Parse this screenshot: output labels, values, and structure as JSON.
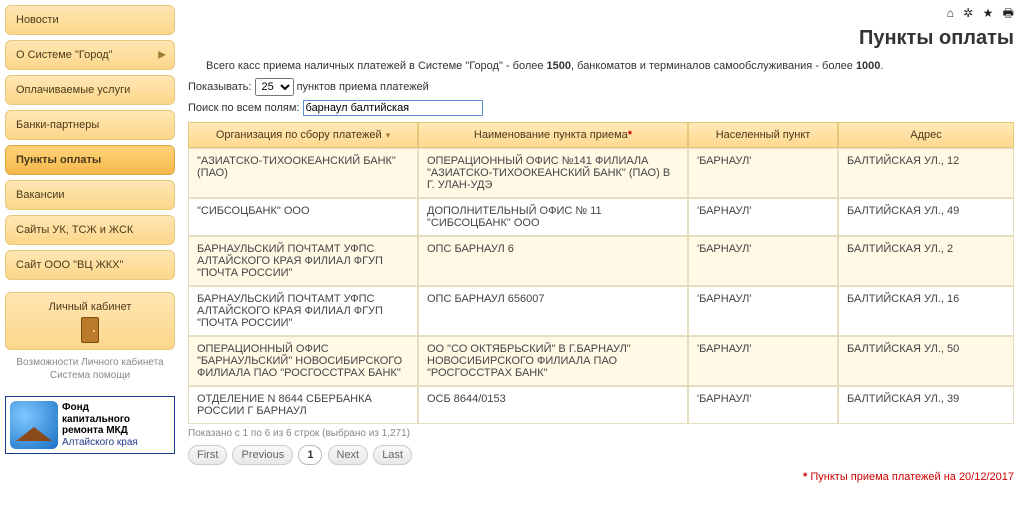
{
  "header": {
    "title": "Пункты оплаты"
  },
  "sidebar": {
    "items": [
      {
        "label": "Новости",
        "arrow": false
      },
      {
        "label": "О Системе \"Город\"",
        "arrow": true
      },
      {
        "label": "Оплачиваемые услуги",
        "arrow": false
      },
      {
        "label": "Банки-партнеры",
        "arrow": false
      },
      {
        "label": "Пункты оплаты",
        "arrow": false,
        "active": true
      },
      {
        "label": "Вакансии",
        "arrow": false
      },
      {
        "label": "Сайты УК, ТСЖ и ЖСК",
        "arrow": false
      },
      {
        "label": "Сайт ООО \"ВЦ ЖКХ\"",
        "arrow": false
      }
    ],
    "lk_label": "Личный кабинет",
    "lk_caption1": "Возможности Личного кабинета",
    "lk_caption2": "Система помощи",
    "banner": {
      "l1": "Фонд",
      "l2": "капитального",
      "l3": "ремонта МКД",
      "l4": "Алтайского края"
    }
  },
  "intro": {
    "prefix": "Всего касс приема наличных платежей в Системе \"Город\" - более ",
    "num1": "1500",
    "mid": ", банкоматов и терминалов самообслуживания - более ",
    "num2": "1000",
    "suffix": "."
  },
  "controls": {
    "show_label": "Показывать: ",
    "show_value": "25",
    "show_suffix": " пунктов приема платежей",
    "search_label": "Поиск по всем полям: ",
    "search_value": "барнаул балтийская"
  },
  "table": {
    "headers": {
      "org": "Организация по сбору платежей",
      "name": "Наименование пункта приема",
      "city": "Населенный пункт",
      "addr": "Адрес"
    },
    "rows": [
      {
        "org": "\"АЗИАТСКО-ТИХООКЕАНСКИЙ БАНК\" (ПАО)",
        "name": "ОПЕРАЦИОННЫЙ ОФИС №141 ФИЛИАЛА \"АЗИАТСКО-ТИХООКЕАНСКИЙ БАНК\" (ПАО) В Г. УЛАН-УДЭ",
        "city": "'БАРНАУЛ'",
        "addr": "БАЛТИЙСКАЯ УЛ., 12"
      },
      {
        "org": "\"СИБСОЦБАНК\" ООО",
        "name": "ДОПОЛНИТЕЛЬНЫЙ ОФИС № 11 \"СИБСОЦБАНК\" ООО",
        "city": "'БАРНАУЛ'",
        "addr": "БАЛТИЙСКАЯ УЛ., 49"
      },
      {
        "org": "БАРНАУЛЬСКИЙ ПОЧТАМТ УФПС АЛТАЙСКОГО КРАЯ ФИЛИАЛ ФГУП \"ПОЧТА РОССИИ\"",
        "name": "ОПС БАРНАУЛ 6",
        "city": "'БАРНАУЛ'",
        "addr": "БАЛТИЙСКАЯ УЛ., 2"
      },
      {
        "org": "БАРНАУЛЬСКИЙ ПОЧТАМТ УФПС АЛТАЙСКОГО КРАЯ ФИЛИАЛ ФГУП \"ПОЧТА РОССИИ\"",
        "name": "ОПС БАРНАУЛ 656007",
        "city": "'БАРНАУЛ'",
        "addr": "БАЛТИЙСКАЯ УЛ., 16"
      },
      {
        "org": "ОПЕРАЦИОННЫЙ ОФИС \"БАРНАУЛЬСКИЙ\" НОВОСИБИРСКОГО ФИЛИАЛА ПАО \"РОСГОССТРАХ БАНК\"",
        "name": "ОО \"СО ОКТЯБРЬСКИЙ\" В Г.БАРНАУЛ\" НОВОСИБИРСКОГО ФИЛИАЛА ПАО \"РОСГОССТРАХ БАНК\"",
        "city": "'БАРНАУЛ'",
        "addr": "БАЛТИЙСКАЯ УЛ., 50"
      },
      {
        "org": "ОТДЕЛЕНИЕ N 8644 СБЕРБАНКА РОССИИ Г БАРНАУЛ",
        "name": "ОСБ 8644/0153",
        "city": "'БАРНАУЛ'",
        "addr": "БАЛТИЙСКАЯ УЛ., 39"
      }
    ],
    "info": "Показано с 1 по 6 из 6 строк (выбрано из 1,271)"
  },
  "pager": {
    "first": "First",
    "prev": "Previous",
    "page": "1",
    "next": "Next",
    "last": "Last"
  },
  "footnote": {
    "ast": "*",
    "text": " Пункты приема платежей на 20/12/2017"
  }
}
